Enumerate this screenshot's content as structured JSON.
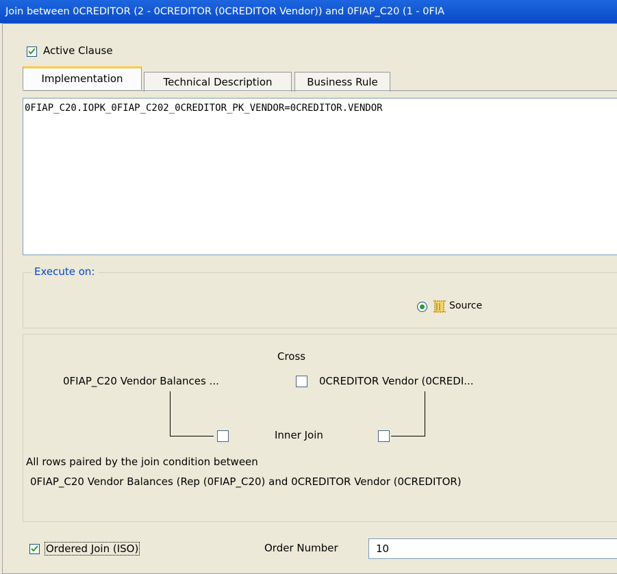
{
  "window": {
    "title": "Join between 0CREDITOR (2 - 0CREDITOR (0CREDITOR Vendor)) and 0FIAP_C20 (1 - 0FIA"
  },
  "active_clause": {
    "label": "Active Clause",
    "checked": true
  },
  "tabs": [
    {
      "label": "Implementation",
      "active": true
    },
    {
      "label": "Technical Description",
      "active": false
    },
    {
      "label": "Business Rule",
      "active": false
    }
  ],
  "editor": {
    "text": "0FIAP_C20.IOPK_0FIAP_C202_0CREDITOR_PK_VENDOR=0CREDITOR.VENDOR"
  },
  "execute_on": {
    "legend": "Execute on:",
    "option_label": "Source",
    "selected": true,
    "icon": "source-datastore-icon"
  },
  "join": {
    "cross_label": "Cross",
    "left_table": "0FIAP_C20 Vendor Balances ...",
    "right_table": "0CREDITOR Vendor (0CREDI...",
    "inner_join_label": "Inner Join",
    "description_line1": "All rows paired by the join condition between",
    "description_line2": "0FIAP_C20 Vendor Balances (Rep (0FIAP_C20) and 0CREDITOR Vendor (0CREDITOR)"
  },
  "ordered_join": {
    "label": "Ordered Join (ISO)",
    "checked": true
  },
  "order_number": {
    "label": "Order Number",
    "value": "10"
  },
  "colors": {
    "title_bar": "#0a4ac6",
    "legend_text": "#0046d5",
    "check_mark": "#21a121",
    "active_tab_accent": "#ffc83c"
  }
}
